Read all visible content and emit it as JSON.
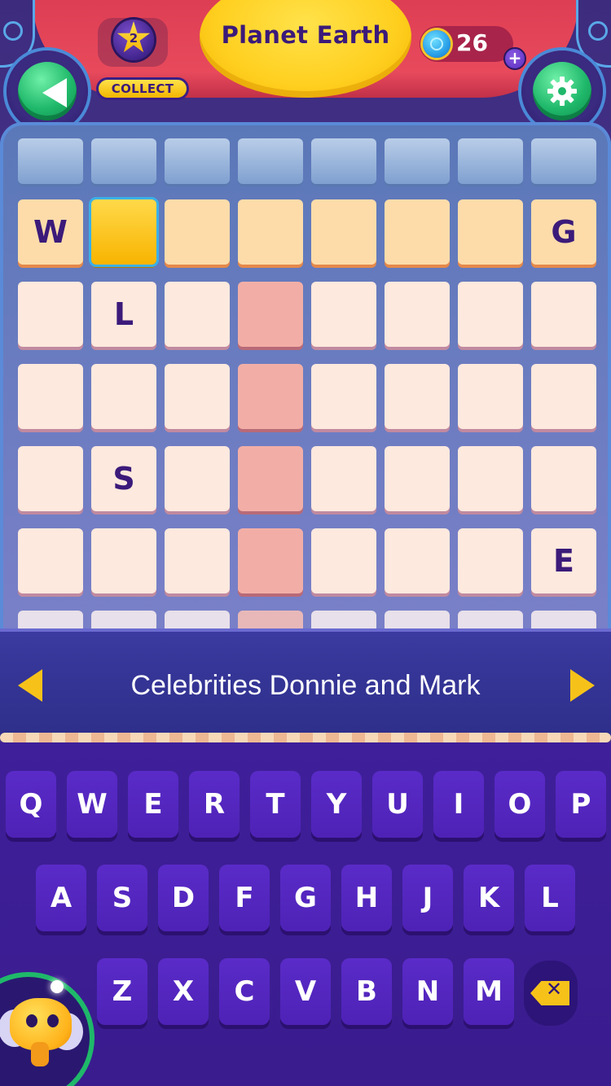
{
  "header": {
    "level_title": "Planet Earth",
    "star_count": "2",
    "collect_label": "COLLECT",
    "coin_count": "26",
    "coin_plus": "+"
  },
  "board": {
    "rows": [
      [
        "",
        "",
        "",
        "",
        "",
        "",
        "",
        ""
      ],
      [
        "W",
        "",
        "",
        "",
        "",
        "",
        "",
        "G"
      ],
      [
        "",
        "L",
        "",
        "",
        "",
        "",
        "",
        ""
      ],
      [
        "",
        "",
        "",
        "",
        "",
        "",
        "",
        ""
      ],
      [
        "",
        "S",
        "",
        "",
        "",
        "",
        "",
        ""
      ],
      [
        "",
        "",
        "",
        "",
        "",
        "",
        "",
        "E"
      ]
    ],
    "selected_cell": "row 2, column 2"
  },
  "clue": {
    "text": "Celebrities Donnie and Mark"
  },
  "keyboard": {
    "row1": [
      "Q",
      "W",
      "E",
      "R",
      "T",
      "Y",
      "U",
      "I",
      "O",
      "P"
    ],
    "row2": [
      "A",
      "S",
      "D",
      "F",
      "G",
      "H",
      "J",
      "K",
      "L"
    ],
    "row3": [
      "Z",
      "X",
      "C",
      "V",
      "B",
      "N",
      "M"
    ],
    "delete_icon": "backspace-icon"
  },
  "colors": {
    "header_red": "#e84a5c",
    "title_yellow": "#ffcf1f",
    "key_purple": "#5a2bc8",
    "accent_yellow": "#f6c21a",
    "button_green": "#1fb86a"
  }
}
